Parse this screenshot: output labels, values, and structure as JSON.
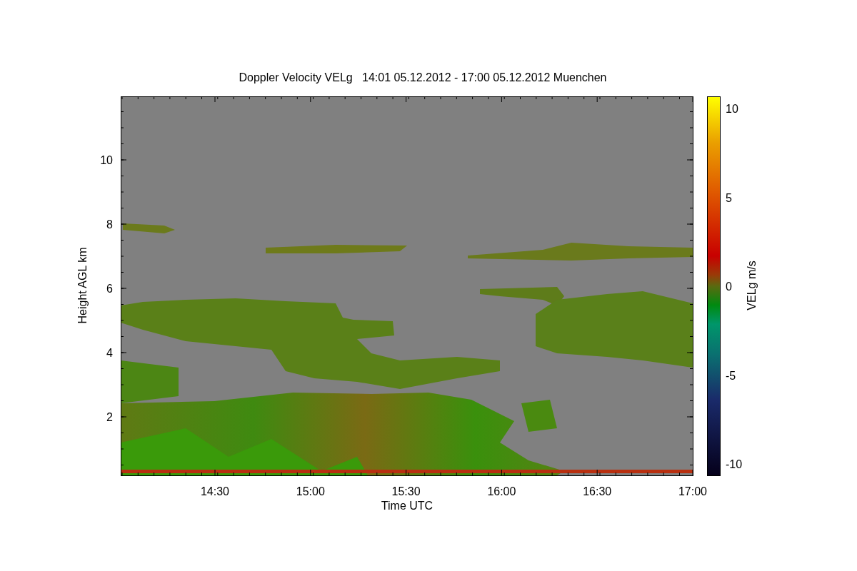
{
  "title": "Doppler Velocity VELg   14:01 05.12.2012 - 17:00 05.12.2012 Muenchen",
  "x_axis": {
    "label": "Time UTC",
    "ticks": [
      "14:30",
      "15:00",
      "15:30",
      "16:00",
      "16:30",
      "17:00"
    ]
  },
  "y_axis": {
    "label": "Height AGL km",
    "ticks": [
      "10",
      "8",
      "6",
      "4",
      "2"
    ]
  },
  "colorbar": {
    "label": "VELg m/s",
    "ticks": [
      "10",
      "5",
      "0",
      "-5",
      "-10"
    ]
  }
}
